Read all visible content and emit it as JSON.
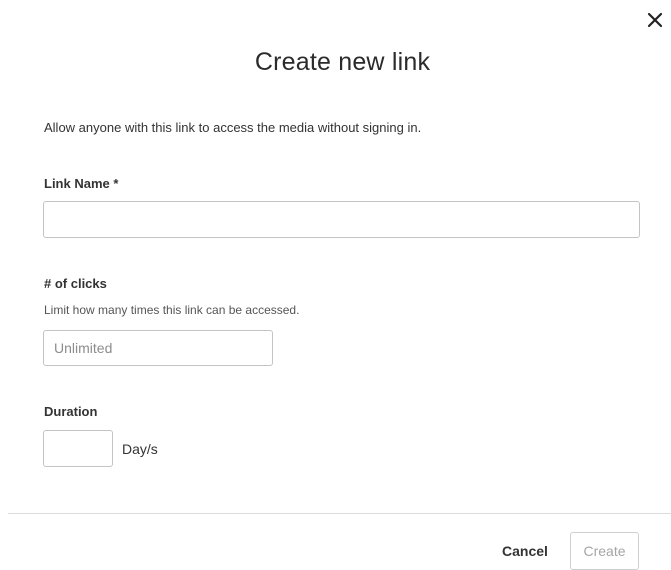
{
  "dialog": {
    "title": "Create new link",
    "description": "Allow anyone with this link to access the media without signing in.",
    "close_icon": "close-icon"
  },
  "form": {
    "link_name": {
      "label": "Link Name *",
      "value": "",
      "placeholder": ""
    },
    "clicks": {
      "label": "# of clicks",
      "hint": "Limit how many times this link can be accessed.",
      "value": "",
      "placeholder": "Unlimited"
    },
    "duration": {
      "label": "Duration",
      "value": "",
      "placeholder": "",
      "unit": "Day/s"
    }
  },
  "footer": {
    "cancel_label": "Cancel",
    "create_label": "Create",
    "create_disabled": true
  },
  "colors": {
    "text": "#333333",
    "border": "#c4c4c4",
    "disabled_text": "#a5a5a5",
    "divider": "#dcdcdc"
  }
}
